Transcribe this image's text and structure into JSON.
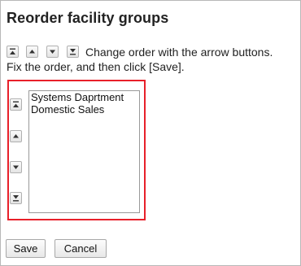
{
  "dialog": {
    "title": "Reorder facility groups"
  },
  "instructions": {
    "line1": "Change order with the arrow buttons.",
    "line2": "Fix the order, and then click [Save]."
  },
  "legend_icons": [
    "move-to-top-icon",
    "move-up-icon",
    "move-down-icon",
    "move-to-bottom-icon"
  ],
  "order_controls": [
    "move-to-top-icon",
    "move-up-icon",
    "move-down-icon",
    "move-to-bottom-icon"
  ],
  "listbox": {
    "items": [
      "Systems Daprtment",
      "Domestic Sales"
    ]
  },
  "actions": {
    "save_label": "Save",
    "cancel_label": "Cancel"
  },
  "colors": {
    "highlight_border": "#e8202a",
    "text": "#222222"
  }
}
